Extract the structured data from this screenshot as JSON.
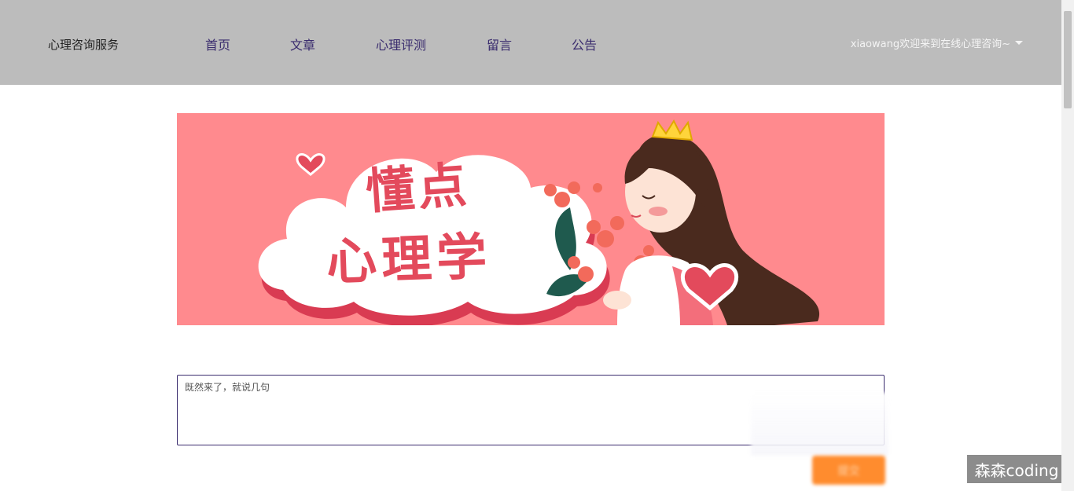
{
  "header": {
    "brand": "心理咨询服务",
    "nav": [
      {
        "label": "首页"
      },
      {
        "label": "文章"
      },
      {
        "label": "心理评测"
      },
      {
        "label": "留言"
      },
      {
        "label": "公告"
      }
    ],
    "user_greeting": "xiaowang欢迎来到在线心理咨询~"
  },
  "banner": {
    "title_line1": "懂点",
    "title_line2": "心理学"
  },
  "message_form": {
    "placeholder": "既然来了，就说几句",
    "value": "",
    "submit_label": "提交"
  },
  "watermark": "森森coding",
  "colors": {
    "header_bg": "#bcbcbc",
    "nav_text": "#3a2c6e",
    "banner_bg": "#ff8a8e",
    "accent_orange": "#ff8c2e"
  }
}
